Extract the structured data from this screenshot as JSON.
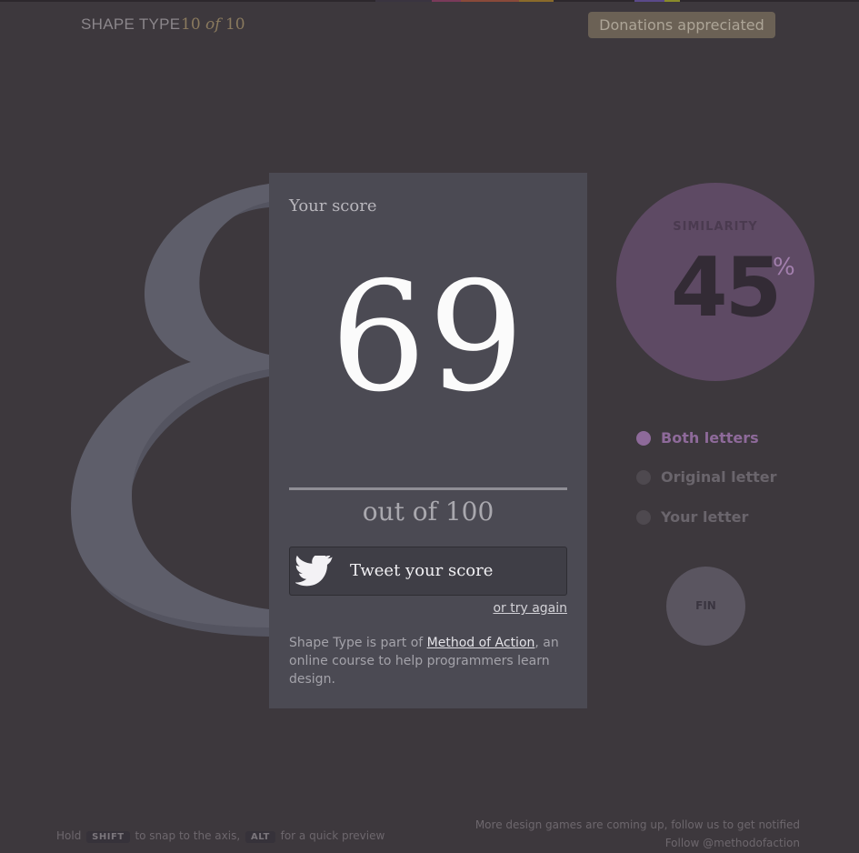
{
  "header": {
    "brand": "SHAPE TYPE",
    "progress_current": "10",
    "progress_of": "of",
    "progress_total": "10",
    "donate_label": "Donations appreciated"
  },
  "glyph": {
    "character": "&",
    "color": "#5e5e6a"
  },
  "score_panel": {
    "heading": "Your score",
    "score": "69",
    "out_of": "out of 100",
    "tweet_label": "Tweet your score",
    "tweet_icon": "twitter-bird-icon",
    "try_again": "or try again",
    "blurb_prefix": "Shape Type is part of ",
    "blurb_link": "Method of Action",
    "blurb_suffix": ", an online course to help programmers learn design."
  },
  "similarity": {
    "label": "SIMILARITY",
    "value": "45",
    "unit": "%"
  },
  "view_options": {
    "both": "Both letters",
    "original": "Original letter",
    "yours": "Your letter",
    "selected": "Both letters"
  },
  "fin_label": "FIN",
  "footer": {
    "hint_hold": "Hold",
    "key_shift": "SHIFT",
    "hint_mid": "to snap to the axis,",
    "key_alt": "ALT",
    "hint_end": "for a quick preview",
    "notice": "More design games are coming up, follow us to get notified",
    "follow": "Follow @methodofaction"
  },
  "colors": {
    "background": "#3d383d",
    "panel": "#4b4a53",
    "accent_purple": "#8e6a9a",
    "similarity_circle": "#5e4a64",
    "donate_button": "#6b6155"
  }
}
